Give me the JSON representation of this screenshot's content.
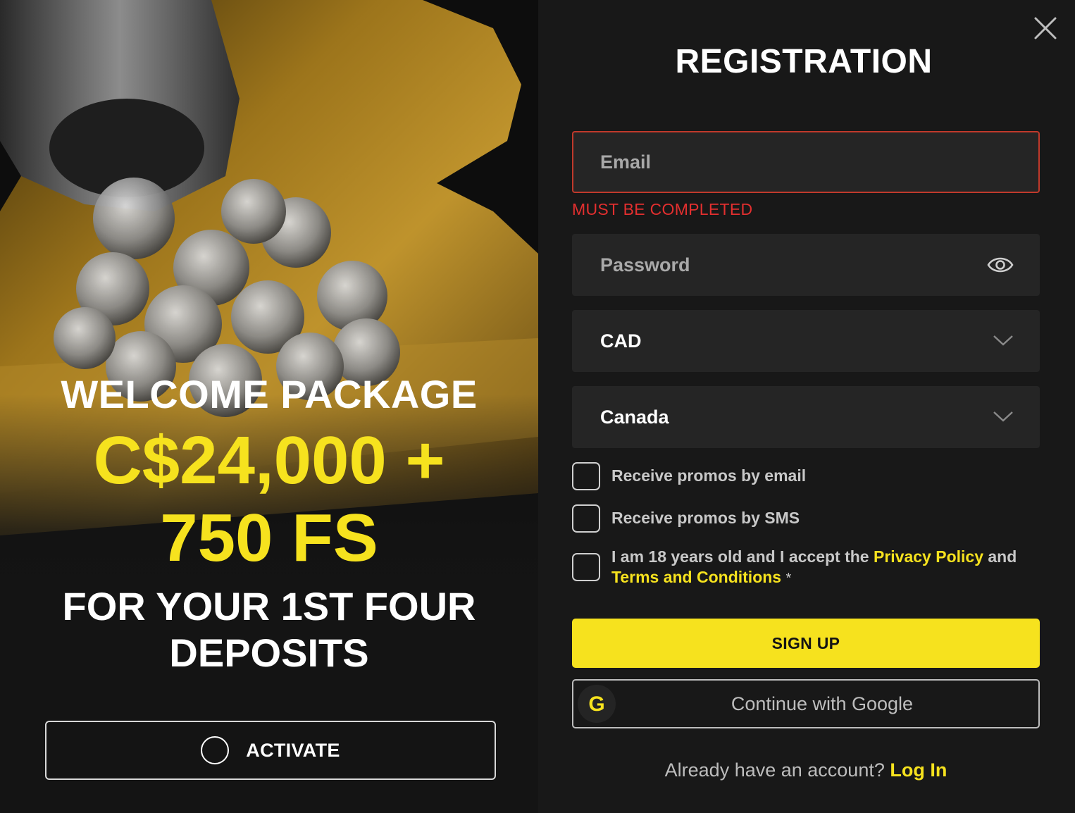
{
  "promo": {
    "welcome": "WELCOME PACKAGE",
    "amount": "C$24,000 +",
    "free_spins": "750 FS",
    "subtitle": "FOR YOUR 1ST FOUR DEPOSITS",
    "activate_label": "ACTIVATE"
  },
  "form": {
    "title": "REGISTRATION",
    "email_placeholder": "Email",
    "email_error": "MUST BE COMPLETED",
    "password_placeholder": "Password",
    "currency": "CAD",
    "country": "Canada",
    "promo_email_label": "Receive promos by email",
    "promo_sms_label": "Receive promos by SMS",
    "terms_prefix": "I am 18 years old and I accept the",
    "privacy_link": "Privacy Policy",
    "terms_and": "and",
    "terms_link": "Terms and Conditions",
    "required_mark": "*",
    "signup_label": "SIGN UP",
    "google_label": "Continue with Google",
    "google_icon_letter": "G",
    "login_prompt": "Already have an account?",
    "login_link": "Log In"
  },
  "colors": {
    "accent": "#f6e21e",
    "error": "#e32f2f",
    "background": "#181818",
    "field": "#252525"
  },
  "icons": [
    "close-icon",
    "eye-icon",
    "chevron-down-icon",
    "google-icon",
    "coins-illustration"
  ]
}
